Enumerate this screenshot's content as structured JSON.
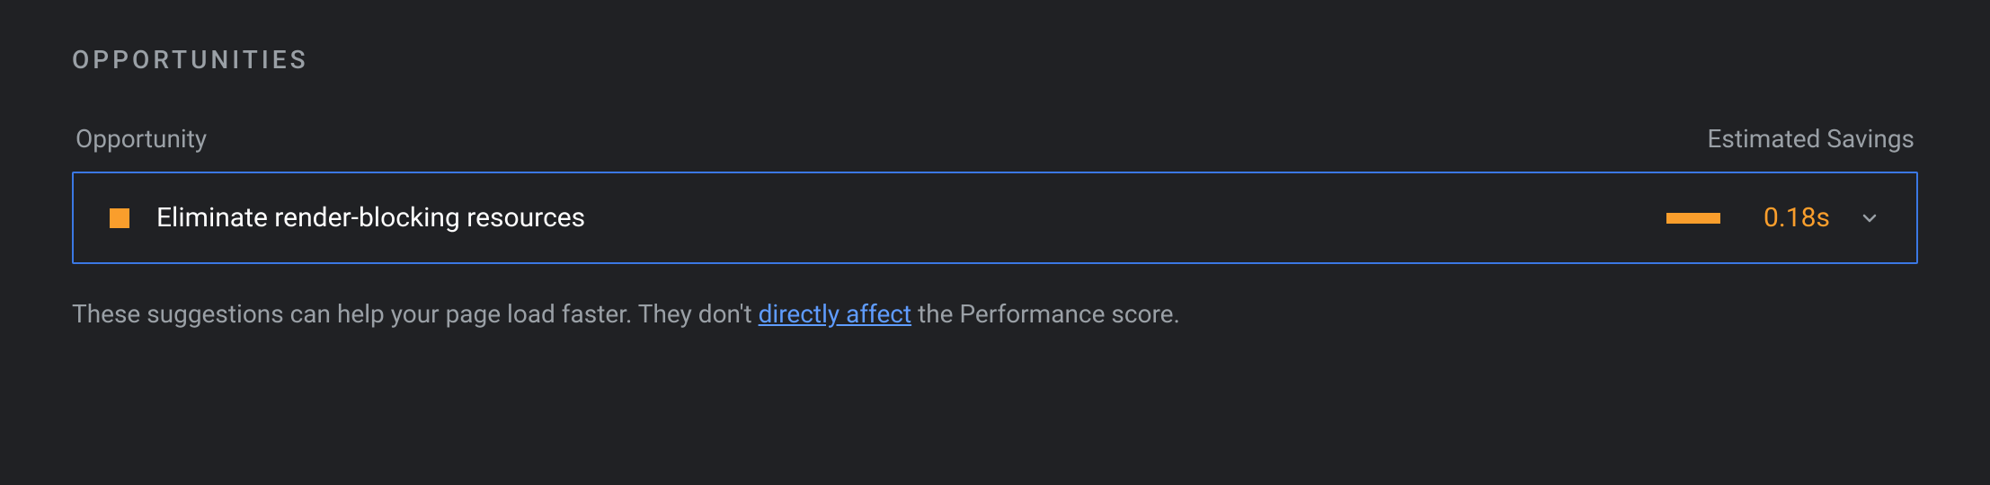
{
  "section": {
    "title": "OPPORTUNITIES",
    "columns": {
      "left": "Opportunity",
      "right": "Estimated Savings"
    },
    "footer": {
      "prefix": "These suggestions can help your page load faster. They don't ",
      "link": "directly affect",
      "suffix": " the Performance score."
    }
  },
  "opportunities": [
    {
      "status_color": "#fa9e2c",
      "label": "Eliminate render-blocking resources",
      "savings_value": "0.18s",
      "savings_bar_color": "#fa9e2c"
    }
  ]
}
